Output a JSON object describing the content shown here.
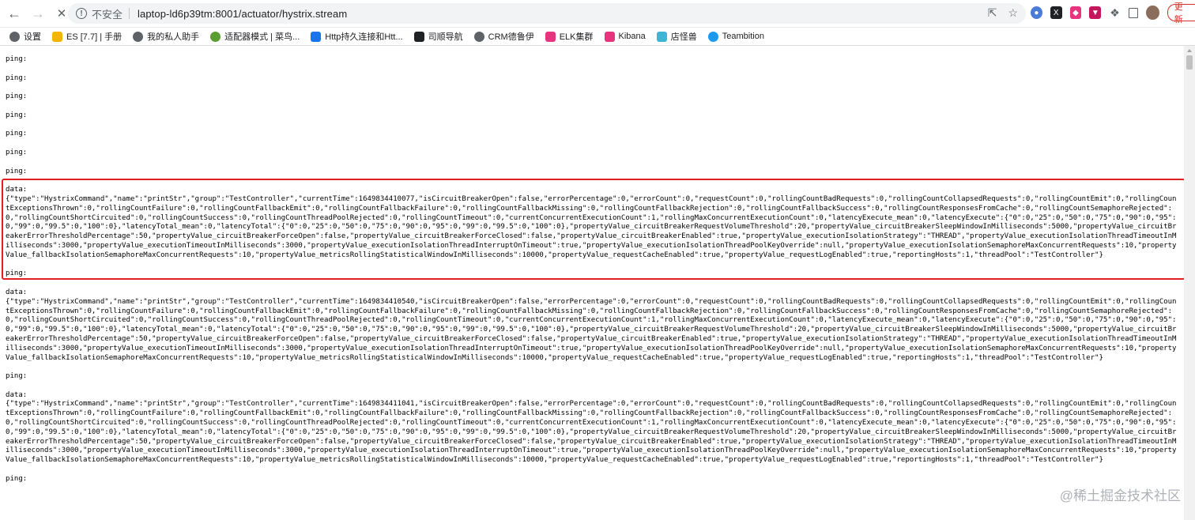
{
  "browser": {
    "security_label": "不安全",
    "url": "laptop-ld6p39tm:8001/actuator/hystrix.stream",
    "update_label": "更新",
    "bookmarks": [
      {
        "label": "设置",
        "color": "#5f6368"
      },
      {
        "label": "ES [7.7] | 手册",
        "color": "#f4b400"
      },
      {
        "label": "我的私人助手",
        "color": "#5f6368"
      },
      {
        "label": "适配器模式 | 菜鸟...",
        "color": "#5a9e33"
      },
      {
        "label": "Http持久连接和Htt...",
        "color": "#1a73e8"
      },
      {
        "label": "司顺导航",
        "color": "#202124"
      },
      {
        "label": "CRM德鲁伊",
        "color": "#5f6368"
      },
      {
        "label": "ELK集群",
        "color": "#e8337f"
      },
      {
        "label": "Kibana",
        "color": "#e8337f"
      },
      {
        "label": "店怪兽",
        "color": "#3fb5d3"
      },
      {
        "label": "Teambition",
        "color": "#1b9aee"
      }
    ]
  },
  "stream": {
    "ping": "ping:",
    "data_label": "data:",
    "events": [
      "{\"type\":\"HystrixCommand\",\"name\":\"printStr\",\"group\":\"TestController\",\"currentTime\":1649834410077,\"isCircuitBreakerOpen\":false,\"errorPercentage\":0,\"errorCount\":0,\"requestCount\":0,\"rollingCountBadRequests\":0,\"rollingCountCollapsedRequests\":0,\"rollingCountEmit\":0,\"rollingCountExceptionsThrown\":0,\"rollingCountFailure\":0,\"rollingCountFallbackEmit\":0,\"rollingCountFallbackFailure\":0,\"rollingCountFallbackMissing\":0,\"rollingCountFallbackRejection\":0,\"rollingCountFallbackSuccess\":0,\"rollingCountResponsesFromCache\":0,\"rollingCountSemaphoreRejected\":0,\"rollingCountShortCircuited\":0,\"rollingCountSuccess\":0,\"rollingCountThreadPoolRejected\":0,\"rollingCountTimeout\":0,\"currentConcurrentExecutionCount\":1,\"rollingMaxConcurrentExecutionCount\":0,\"latencyExecute_mean\":0,\"latencyExecute\":{\"0\":0,\"25\":0,\"50\":0,\"75\":0,\"90\":0,\"95\":0,\"99\":0,\"99.5\":0,\"100\":0},\"latencyTotal_mean\":0,\"latencyTotal\":{\"0\":0,\"25\":0,\"50\":0,\"75\":0,\"90\":0,\"95\":0,\"99\":0,\"99.5\":0,\"100\":0},\"propertyValue_circuitBreakerRequestVolumeThreshold\":20,\"propertyValue_circuitBreakerSleepWindowInMilliseconds\":5000,\"propertyValue_circuitBreakerErrorThresholdPercentage\":50,\"propertyValue_circuitBreakerForceOpen\":false,\"propertyValue_circuitBreakerForceClosed\":false,\"propertyValue_circuitBreakerEnabled\":true,\"propertyValue_executionIsolationStrategy\":\"THREAD\",\"propertyValue_executionIsolationThreadTimeoutInMilliseconds\":3000,\"propertyValue_executionTimeoutInMilliseconds\":3000,\"propertyValue_executionIsolationThreadInterruptOnTimeout\":true,\"propertyValue_executionIsolationThreadPoolKeyOverride\":null,\"propertyValue_executionIsolationSemaphoreMaxConcurrentRequests\":10,\"propertyValue_fallbackIsolationSemaphoreMaxConcurrentRequests\":10,\"propertyValue_metricsRollingStatisticalWindowInMilliseconds\":10000,\"propertyValue_requestCacheEnabled\":true,\"propertyValue_requestLogEnabled\":true,\"reportingHosts\":1,\"threadPool\":\"TestController\"}",
      "{\"type\":\"HystrixCommand\",\"name\":\"printStr\",\"group\":\"TestController\",\"currentTime\":1649834410540,\"isCircuitBreakerOpen\":false,\"errorPercentage\":0,\"errorCount\":0,\"requestCount\":0,\"rollingCountBadRequests\":0,\"rollingCountCollapsedRequests\":0,\"rollingCountEmit\":0,\"rollingCountExceptionsThrown\":0,\"rollingCountFailure\":0,\"rollingCountFallbackEmit\":0,\"rollingCountFallbackFailure\":0,\"rollingCountFallbackMissing\":0,\"rollingCountFallbackRejection\":0,\"rollingCountFallbackSuccess\":0,\"rollingCountResponsesFromCache\":0,\"rollingCountSemaphoreRejected\":0,\"rollingCountShortCircuited\":0,\"rollingCountSuccess\":0,\"rollingCountThreadPoolRejected\":0,\"rollingCountTimeout\":0,\"currentConcurrentExecutionCount\":1,\"rollingMaxConcurrentExecutionCount\":0,\"latencyExecute_mean\":0,\"latencyExecute\":{\"0\":0,\"25\":0,\"50\":0,\"75\":0,\"90\":0,\"95\":0,\"99\":0,\"99.5\":0,\"100\":0},\"latencyTotal_mean\":0,\"latencyTotal\":{\"0\":0,\"25\":0,\"50\":0,\"75\":0,\"90\":0,\"95\":0,\"99\":0,\"99.5\":0,\"100\":0},\"propertyValue_circuitBreakerRequestVolumeThreshold\":20,\"propertyValue_circuitBreakerSleepWindowInMilliseconds\":5000,\"propertyValue_circuitBreakerErrorThresholdPercentage\":50,\"propertyValue_circuitBreakerForceOpen\":false,\"propertyValue_circuitBreakerForceClosed\":false,\"propertyValue_circuitBreakerEnabled\":true,\"propertyValue_executionIsolationStrategy\":\"THREAD\",\"propertyValue_executionIsolationThreadTimeoutInMilliseconds\":3000,\"propertyValue_executionTimeoutInMilliseconds\":3000,\"propertyValue_executionIsolationThreadInterruptOnTimeout\":true,\"propertyValue_executionIsolationThreadPoolKeyOverride\":null,\"propertyValue_executionIsolationSemaphoreMaxConcurrentRequests\":10,\"propertyValue_fallbackIsolationSemaphoreMaxConcurrentRequests\":10,\"propertyValue_metricsRollingStatisticalWindowInMilliseconds\":10000,\"propertyValue_requestCacheEnabled\":true,\"propertyValue_requestLogEnabled\":true,\"reportingHosts\":1,\"threadPool\":\"TestController\"}",
      "{\"type\":\"HystrixCommand\",\"name\":\"printStr\",\"group\":\"TestController\",\"currentTime\":1649834411041,\"isCircuitBreakerOpen\":false,\"errorPercentage\":0,\"errorCount\":0,\"requestCount\":0,\"rollingCountBadRequests\":0,\"rollingCountCollapsedRequests\":0,\"rollingCountEmit\":0,\"rollingCountExceptionsThrown\":0,\"rollingCountFailure\":0,\"rollingCountFallbackEmit\":0,\"rollingCountFallbackFailure\":0,\"rollingCountFallbackMissing\":0,\"rollingCountFallbackRejection\":0,\"rollingCountFallbackSuccess\":0,\"rollingCountResponsesFromCache\":0,\"rollingCountSemaphoreRejected\":0,\"rollingCountShortCircuited\":0,\"rollingCountSuccess\":0,\"rollingCountThreadPoolRejected\":0,\"rollingCountTimeout\":0,\"currentConcurrentExecutionCount\":1,\"rollingMaxConcurrentExecutionCount\":0,\"latencyExecute_mean\":0,\"latencyExecute\":{\"0\":0,\"25\":0,\"50\":0,\"75\":0,\"90\":0,\"95\":0,\"99\":0,\"99.5\":0,\"100\":0},\"latencyTotal_mean\":0,\"latencyTotal\":{\"0\":0,\"25\":0,\"50\":0,\"75\":0,\"90\":0,\"95\":0,\"99\":0,\"99.5\":0,\"100\":0},\"propertyValue_circuitBreakerRequestVolumeThreshold\":20,\"propertyValue_circuitBreakerSleepWindowInMilliseconds\":5000,\"propertyValue_circuitBreakerErrorThresholdPercentage\":50,\"propertyValue_circuitBreakerForceOpen\":false,\"propertyValue_circuitBreakerForceClosed\":false,\"propertyValue_circuitBreakerEnabled\":true,\"propertyValue_executionIsolationStrategy\":\"THREAD\",\"propertyValue_executionIsolationThreadTimeoutInMilliseconds\":3000,\"propertyValue_executionTimeoutInMilliseconds\":3000,\"propertyValue_executionIsolationThreadInterruptOnTimeout\":true,\"propertyValue_executionIsolationThreadPoolKeyOverride\":null,\"propertyValue_executionIsolationSemaphoreMaxConcurrentRequests\":10,\"propertyValue_fallbackIsolationSemaphoreMaxConcurrentRequests\":10,\"propertyValue_metricsRollingStatisticalWindowInMilliseconds\":10000,\"propertyValue_requestCacheEnabled\":true,\"propertyValue_requestLogEnabled\":true,\"reportingHosts\":1,\"threadPool\":\"TestController\"}"
    ]
  },
  "watermark": "@稀土掘金技术社区",
  "colors": {
    "highlight": "#e02020",
    "update": "#d93025"
  }
}
